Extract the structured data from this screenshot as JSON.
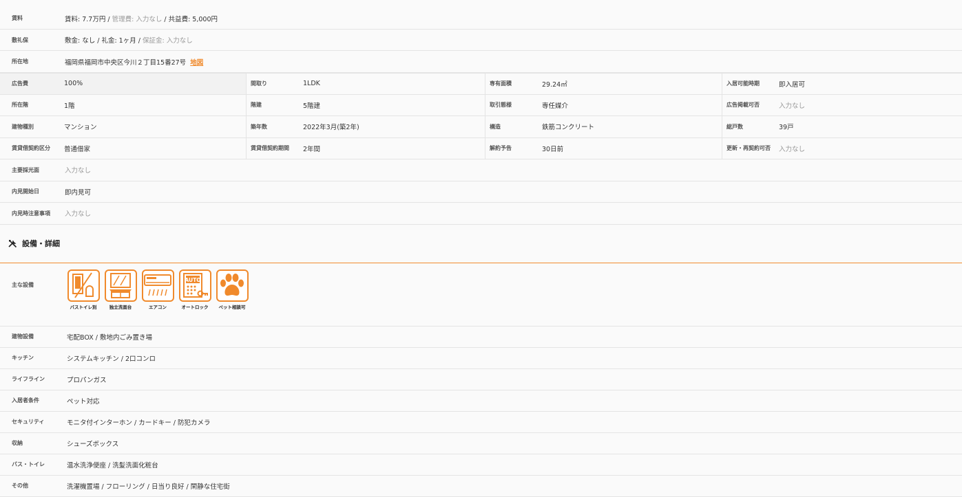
{
  "rent": {
    "label": "賃料",
    "rent": "賃料: 7.7万円",
    "sep1": " / ",
    "mgmt": "管理費: 入力なし",
    "sep2": " / ",
    "common": "共益費: 5,000円"
  },
  "deposit": {
    "label": "敷礼保",
    "text": "敷金: なし / 礼金: 1ヶ月 /",
    "guarantee": "保証金: 入力なし"
  },
  "location": {
    "label": "所在地",
    "address": "福岡県福岡市中央区今川２丁目15番27号",
    "map": "地図"
  },
  "grid": [
    [
      {
        "label": "広告費",
        "value": "100%"
      },
      {
        "label": "間取り",
        "value": "1LDK"
      },
      {
        "label": "専有面積",
        "value": "29.24㎡"
      },
      {
        "label": "入居可能時期",
        "value": "即入居可"
      }
    ],
    [
      {
        "label": "所在階",
        "value": "1階"
      },
      {
        "label": "階建",
        "value": "5階建"
      },
      {
        "label": "取引態様",
        "value": "専任媒介"
      },
      {
        "label": "広告掲載可否",
        "value": "入力なし",
        "muted": true
      }
    ],
    [
      {
        "label": "建物種別",
        "value": "マンション"
      },
      {
        "label": "築年数",
        "value": "2022年3月(築2年)"
      },
      {
        "label": "構造",
        "value": "鉄筋コンクリート"
      },
      {
        "label": "総戸数",
        "value": "39戸"
      }
    ],
    [
      {
        "label": "賃貸借契約区分",
        "value": "普通借家"
      },
      {
        "label": "賃貸借契約期間",
        "value": "2年間"
      },
      {
        "label": "解約予告",
        "value": "30日前"
      },
      {
        "label": "更新・再契約可否",
        "value": "入力なし",
        "muted": true
      }
    ]
  ],
  "rows1": [
    {
      "label": "主要採光面",
      "value": "入力なし",
      "muted": true
    },
    {
      "label": "内見開始日",
      "value": "即内見可",
      "muted": false
    },
    {
      "label": "内見時注意事項",
      "value": "入力なし",
      "muted": true
    }
  ],
  "section": {
    "title": "設備・詳細"
  },
  "main_equipment": {
    "label": "主な設備",
    "icons": [
      {
        "name": "bath-toilet-separate-icon",
        "caption": "バストイレ別"
      },
      {
        "name": "vanity-icon",
        "caption": "独立洗面台"
      },
      {
        "name": "air-conditioner-icon",
        "caption": "エアコン"
      },
      {
        "name": "auto-lock-icon",
        "caption": "オートロック",
        "badge": "AUTO"
      },
      {
        "name": "pet-icon",
        "caption": "ペット相談可"
      }
    ]
  },
  "rows2": [
    {
      "label": "建物設備",
      "value": "宅配BOX / 敷地内ごみ置き場"
    },
    {
      "label": "キッチン",
      "value": "システムキッチン / 2口コンロ"
    },
    {
      "label": "ライフライン",
      "value": "プロパンガス"
    },
    {
      "label": "入居者条件",
      "value": "ペット対応"
    },
    {
      "label": "セキュリティ",
      "value": "モニタ付インターホン / カードキー / 防犯カメラ"
    },
    {
      "label": "収納",
      "value": "シューズボックス"
    },
    {
      "label": "バス・トイレ",
      "value": "温水洗浄便座 / 洗髪洗面化粧台"
    },
    {
      "label": "その他",
      "value": "洗濯機置場 / フローリング / 日当り良好 / 閑静な住宅街"
    }
  ],
  "colors": {
    "accent": "#f08a2c",
    "border": "#e4e4e4",
    "muted": "#999999"
  }
}
